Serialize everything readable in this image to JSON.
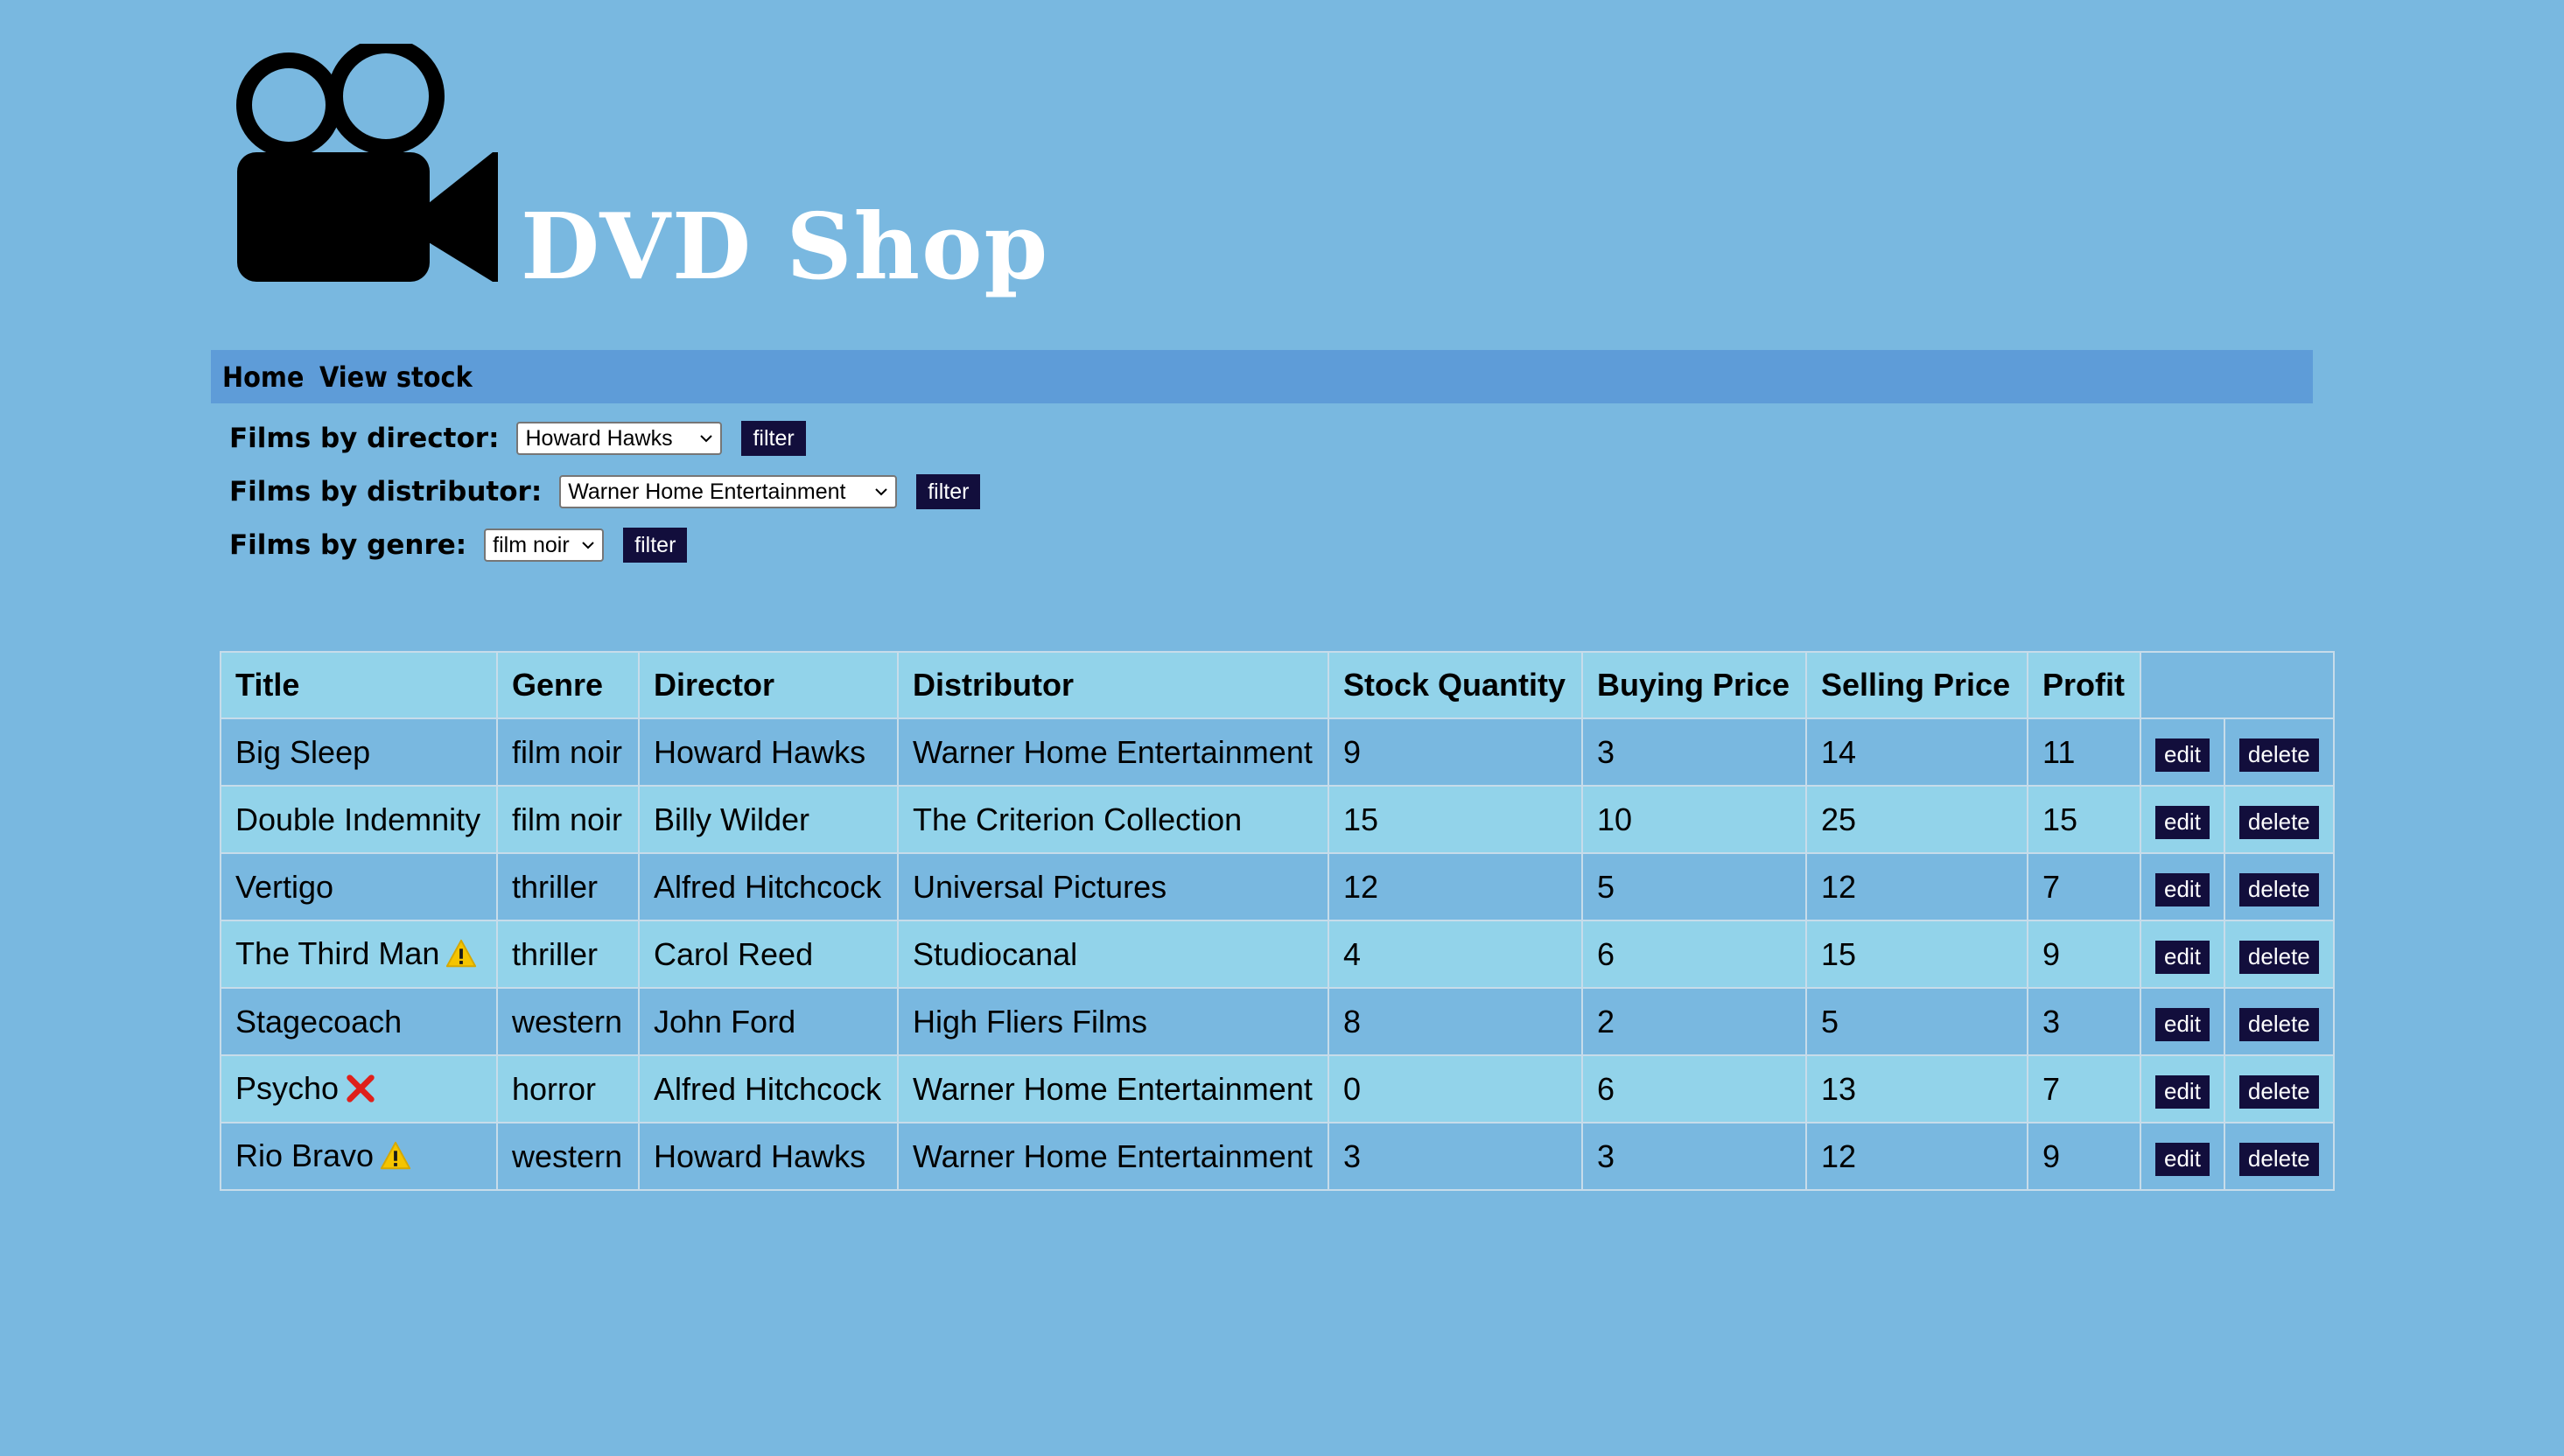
{
  "site": {
    "title": "DVD Shop",
    "logo_icon": "video-camera-icon"
  },
  "nav": {
    "items": [
      "Home",
      "View stock"
    ]
  },
  "filters": [
    {
      "label": "Films by director:",
      "selected": "Howard Hawks",
      "button": "filter"
    },
    {
      "label": "Films by distributor:",
      "selected": "Warner Home Entertainment",
      "button": "filter"
    },
    {
      "label": "Films by genre:",
      "selected": "film noir",
      "button": "filter"
    }
  ],
  "table": {
    "headers": [
      "Title",
      "Genre",
      "Director",
      "Distributor",
      "Stock Quantity",
      "Buying Price",
      "Selling Price",
      "Profit"
    ],
    "edit_label": "edit",
    "delete_label": "delete",
    "rows": [
      {
        "title": "Big Sleep",
        "status": "",
        "genre": "film noir",
        "director": "Howard Hawks",
        "distributor": "Warner Home Entertainment",
        "stock": "9",
        "buying": "3",
        "selling": "14",
        "profit": "11"
      },
      {
        "title": "Double Indemnity",
        "status": "",
        "genre": "film noir",
        "director": "Billy Wilder",
        "distributor": "The Criterion Collection",
        "stock": "15",
        "buying": "10",
        "selling": "25",
        "profit": "15"
      },
      {
        "title": "Vertigo",
        "status": "",
        "genre": "thriller",
        "director": "Alfred Hitchcock",
        "distributor": "Universal Pictures",
        "stock": "12",
        "buying": "5",
        "selling": "12",
        "profit": "7"
      },
      {
        "title": "The Third Man",
        "status": "warning-icon",
        "genre": "thriller",
        "director": "Carol Reed",
        "distributor": "Studiocanal",
        "stock": "4",
        "buying": "6",
        "selling": "15",
        "profit": "9"
      },
      {
        "title": "Stagecoach",
        "status": "",
        "genre": "western",
        "director": "John Ford",
        "distributor": "High Fliers Films",
        "stock": "8",
        "buying": "2",
        "selling": "5",
        "profit": "3"
      },
      {
        "title": "Psycho",
        "status": "cross-icon",
        "genre": "horror",
        "director": "Alfred Hitchcock",
        "distributor": "Warner Home Entertainment",
        "stock": "0",
        "buying": "6",
        "selling": "13",
        "profit": "7"
      },
      {
        "title": "Rio Bravo",
        "status": "warning-icon",
        "genre": "western",
        "director": "Howard Hawks",
        "distributor": "Warner Home Entertainment",
        "stock": "3",
        "buying": "3",
        "selling": "12",
        "profit": "9"
      }
    ]
  },
  "colors": {
    "page_bg": "#79b8e0",
    "nav_bg": "#5e9cd8",
    "row_alt": "#92d3ea",
    "button_bg": "#120e3c",
    "warning": "#f5c400",
    "error": "#e0201b"
  }
}
